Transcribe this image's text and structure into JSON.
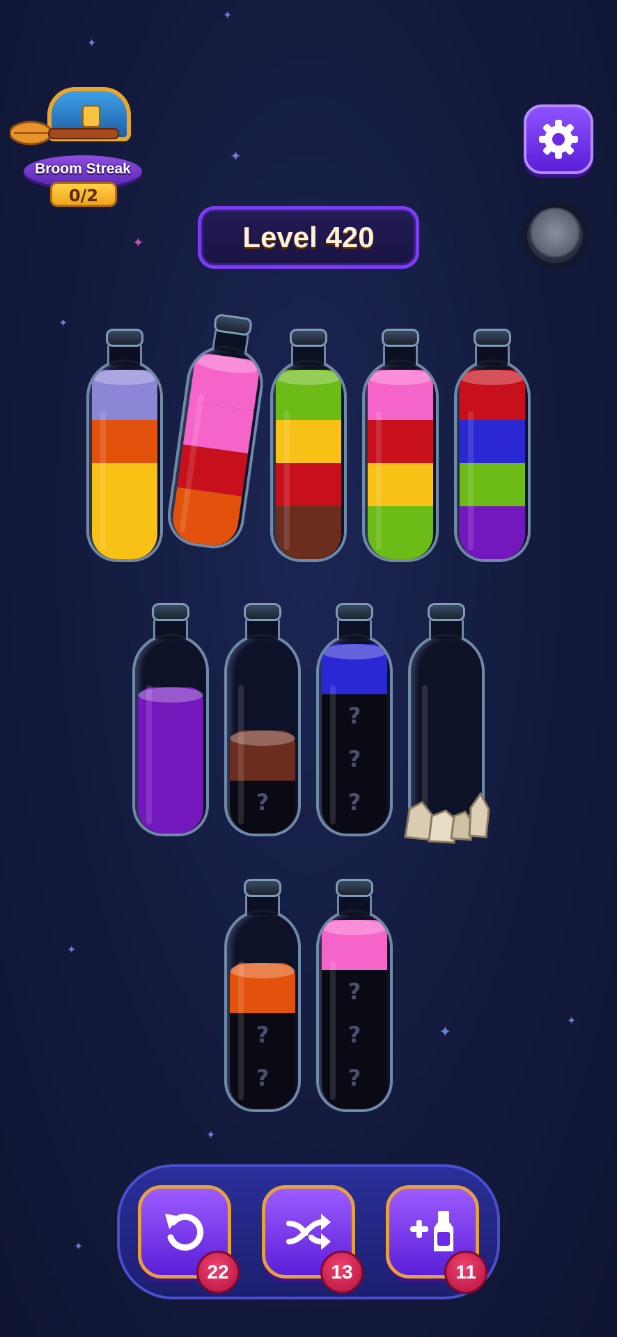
{
  "hud": {
    "streak_label": "Broom Streak",
    "streak_count": "0/2",
    "level_label": "Level 420",
    "settings_icon": "gear-icon",
    "toggle_icon": "circle-toggle-icon"
  },
  "colors": {
    "lavender": "#8c86d6",
    "orange": "#e2520c",
    "yellow": "#f8c116",
    "pink": "#f565c9",
    "red": "#c7101c",
    "green": "#6cbb17",
    "brown": "#6b2d1e",
    "blue": "#2a28d2",
    "purple": "#7318bd",
    "hidden": "#0a0a14"
  },
  "bottles": [
    {
      "id": "1",
      "layers": [
        "lavender",
        "orange",
        "yellow",
        "yellow"
      ]
    },
    {
      "id": "2",
      "layers": [
        "pink",
        "pink",
        "red",
        "orange"
      ],
      "lifted": true
    },
    {
      "id": "3",
      "layers": [
        "green",
        "yellow",
        "red",
        "brown"
      ]
    },
    {
      "id": "4",
      "layers": [
        "pink",
        "red",
        "yellow",
        "green"
      ]
    },
    {
      "id": "5",
      "layers": [
        "red",
        "blue",
        "green",
        "purple"
      ]
    },
    {
      "id": "6",
      "layers": [
        "empty",
        "purple",
        "purple",
        "purple"
      ]
    },
    {
      "id": "7",
      "layers": [
        "empty",
        "empty",
        "brown",
        "hidden"
      ]
    },
    {
      "id": "8",
      "layers": [
        "blue",
        "hidden",
        "hidden",
        "hidden"
      ]
    },
    {
      "id": "9",
      "layers": [
        "empty",
        "empty",
        "empty",
        "empty"
      ],
      "blocked_by_rocks": true
    },
    {
      "id": "10",
      "layers": [
        "empty",
        "orange",
        "hidden",
        "hidden"
      ]
    },
    {
      "id": "11",
      "layers": [
        "pink",
        "hidden",
        "hidden",
        "hidden"
      ]
    }
  ],
  "hidden_mark": "?",
  "powerups": [
    {
      "name": "undo",
      "icon": "undo-icon",
      "count": "22"
    },
    {
      "name": "shuffle",
      "icon": "shuffle-icon",
      "count": "13"
    },
    {
      "name": "add-bottle",
      "icon": "add-bottle-icon",
      "count": "11"
    }
  ]
}
